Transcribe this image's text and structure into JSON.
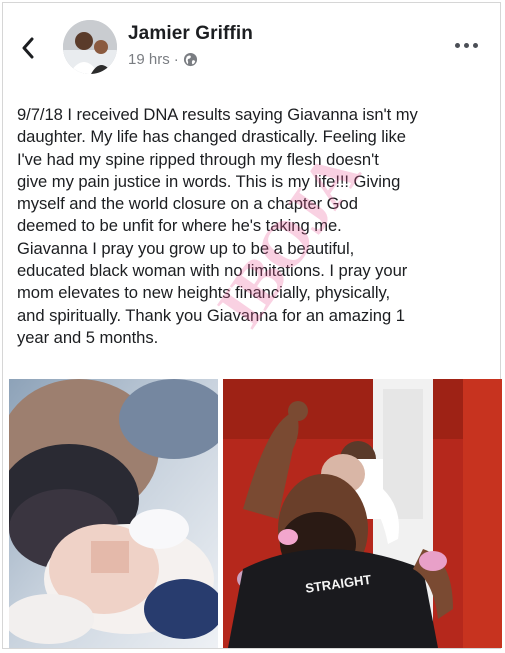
{
  "post": {
    "author": "Jamier Griffin",
    "time": "19 hrs",
    "separator": "·",
    "text": "9/7/18 I received DNA results saying Giavanna isn't my\ndaughter. My life has changed drastically. Feeling like\nI've had my spine ripped through my flesh doesn't\ngive my pain justice in words. This is my life!!! Giving\nmyself and the world closure on a chapter God\ndeemed to be unfit for where he's taking me.\nGiavanna I pray you grow up to be a beautiful,\neducated black woman with no limitations. I pray your\nmom elevates to new heights financially, physically,\nand spiritually. Thank you Giavanna for an amazing 1\nyear and 5 months.",
    "watermark": "IBOJA"
  },
  "photos": {
    "shirt_text": "STRAIGHT"
  },
  "icons": {
    "back": "chevron-left-icon",
    "privacy": "globe-icon",
    "more": "more-dots-icon"
  },
  "colors": {
    "text": "#1c1e21",
    "meta": "#7a7d82",
    "watermark": "#eb5a96",
    "wall_red": "#b5281c"
  }
}
